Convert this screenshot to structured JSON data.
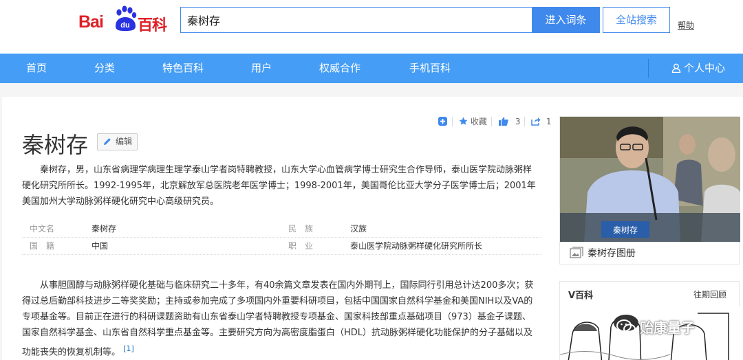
{
  "header": {
    "logo_bai": "Bai",
    "logo_du": "du",
    "logo_baike": "百科",
    "search_value": "秦树存",
    "enter_button": "进入词条",
    "search_all_button": "全站搜索",
    "help_link": "帮助"
  },
  "nav": {
    "items": [
      {
        "label": "首页"
      },
      {
        "label": "分类"
      },
      {
        "label": "特色百科"
      },
      {
        "label": "用户"
      },
      {
        "label": "权威合作"
      },
      {
        "label": "手机百科"
      }
    ],
    "user_center": "个人中心"
  },
  "article": {
    "title": "秦树存",
    "edit_label": "编辑",
    "collect_label": "收藏",
    "like_count": "3",
    "share_count": "1",
    "summary": "秦树存，男，山东省病理学病理生理学泰山学者岗特聘教授，山东大学心血管病学博士研究生合作导师，泰山医学院动脉粥样硬化研究所所长。1992-1995年，北京解放军总医院老年医学博士；1998-2001年，美国哥伦比亚大学分子医学博士后；2001年美国加州大学动脉粥样硬化研究中心高级研究员。",
    "info": [
      {
        "key1": "中文名",
        "val1": "秦树存",
        "key2": "民　族",
        "val2": "汉族"
      },
      {
        "key1": "国　籍",
        "val1": "中国",
        "key2": "职　业",
        "val2": "泰山医学院动脉粥样硬化研究所所长"
      }
    ],
    "body": "从事胆固醇与动脉粥样硬化基础与临床研究二十多年，有40余篇文章发表在国内外期刊上，国际同行引用总计达200多次；获得过总后勤部科技进步二等奖奖励；主持或参加完成了多项国内外重要科研项目，包括中国国家自然科学基金和美国NIH以及VA的专项基金等。目前正在进行的科研课题资助有山东省泰山学者特聘教授专项基金、国家科技部重点基础项目（973）基金子课题、国家自然科学基金、山东省自然科学重点基金等。主要研究方向为高密度脂蛋白（HDL）抗动脉粥样硬化功能保护的分子基础以及功能丧失的恢复机制等。",
    "body_ref": "[1]"
  },
  "sidebar": {
    "photo_nameplate": "秦树存",
    "album_label": "秦树存图册",
    "vbaike_title": "V百科",
    "vbaike_link": "往期回顾",
    "watermark": "贻康量子"
  },
  "colors": {
    "brand_red": "#de1f26",
    "brand_blue": "#3f89ec",
    "nav_blue": "#459df5"
  }
}
